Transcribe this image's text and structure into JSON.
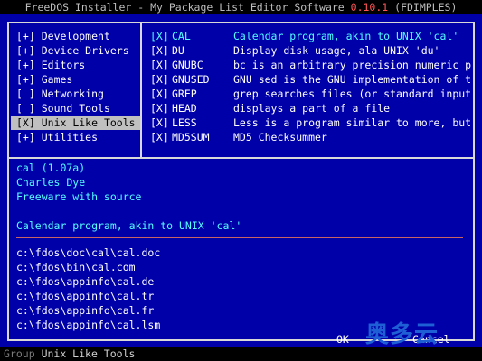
{
  "title": {
    "text": "FreeDOS Installer - My Package List Editor Software",
    "version": "0.10.1",
    "suffix": "(FDIMPLES)"
  },
  "groups": [
    {
      "mark": "[+]",
      "label": "Development"
    },
    {
      "mark": "[+]",
      "label": "Device Drivers"
    },
    {
      "mark": "[+]",
      "label": "Editors"
    },
    {
      "mark": "[+]",
      "label": "Games"
    },
    {
      "mark": "[ ]",
      "label": "Networking"
    },
    {
      "mark": "[ ]",
      "label": "Sound Tools"
    },
    {
      "mark": "[X]",
      "label": "Unix Like Tools"
    },
    {
      "mark": "[+]",
      "label": "Utilities"
    }
  ],
  "packages": [
    {
      "check": "[X]",
      "name": "CAL",
      "desc": "Calendar program, akin to UNIX 'cal'"
    },
    {
      "check": "[X]",
      "name": "DU",
      "desc": "Display disk usage, ala UNIX 'du'"
    },
    {
      "check": "[X]",
      "name": "GNUBC",
      "desc": "bc is an arbitrary precision numeric pr"
    },
    {
      "check": "[X]",
      "name": "GNUSED",
      "desc": "GNU sed is the GNU implementation of th"
    },
    {
      "check": "[X]",
      "name": "GREP",
      "desc": "grep searches files (or standard input)"
    },
    {
      "check": "[X]",
      "name": "HEAD",
      "desc": "displays a part of a file"
    },
    {
      "check": "[X]",
      "name": "LESS",
      "desc": "Less is a program similar to more, but"
    },
    {
      "check": "[X]",
      "name": "MD5SUM",
      "desc": "MD5 Checksummer"
    }
  ],
  "info": {
    "name_version": "cal (1.07a)",
    "author": "Charles Dye",
    "license": "Freeware with source",
    "description": "Calendar program, akin to UNIX 'cal'"
  },
  "files": [
    "c:\\fdos\\doc\\cal\\cal.doc",
    "c:\\fdos\\bin\\cal.com",
    "c:\\fdos\\appinfo\\cal.de",
    "c:\\fdos\\appinfo\\cal.tr",
    "c:\\fdos\\appinfo\\cal.fr",
    "c:\\fdos\\appinfo\\cal.lsm"
  ],
  "buttons": {
    "ok": "OK",
    "cancel": "Cancel"
  },
  "watermark": "奥多云",
  "status": {
    "label": "Group",
    "value": "Unix Like Tools"
  },
  "colors": {
    "background": "#0000a8",
    "highlight": "#55ffff",
    "selected_bg": "#c0c0c0",
    "version": "#ff5555"
  }
}
